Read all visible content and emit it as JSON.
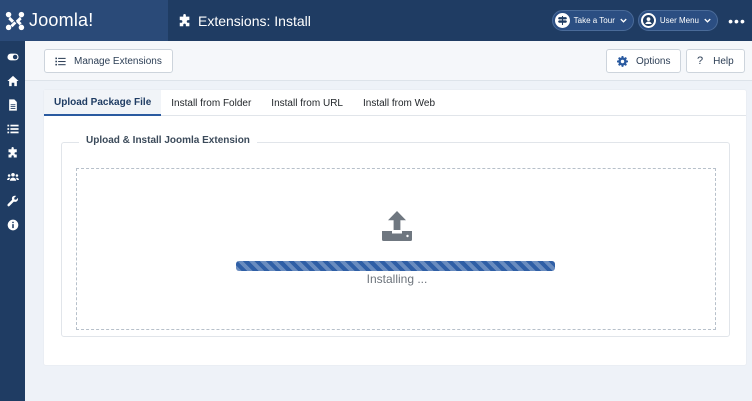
{
  "header": {
    "brand": "Joomla!",
    "page_title": "Extensions: Install",
    "take_tour": "Take a Tour",
    "user_menu": "User Menu",
    "more": "•••"
  },
  "sidebar": {
    "icons": [
      "toggle-icon",
      "home-icon",
      "document-icon",
      "list-icon",
      "puzzle-icon",
      "users-icon",
      "wrench-icon",
      "info-icon"
    ]
  },
  "toolbar": {
    "manage_extensions": "Manage Extensions",
    "options": "Options",
    "help": "Help"
  },
  "tabs": [
    "Upload Package File",
    "Install from Folder",
    "Install from URL",
    "Install from Web"
  ],
  "active_tab": 0,
  "install": {
    "legend": "Upload & Install Joomla Extension",
    "status": "Installing ...",
    "progress": 1.0
  },
  "colors": {
    "header_bg": "#1f3c63",
    "brand_bg": "#2a4a78",
    "progress": "#2f5fa6",
    "page_bg": "#eef2f8"
  }
}
